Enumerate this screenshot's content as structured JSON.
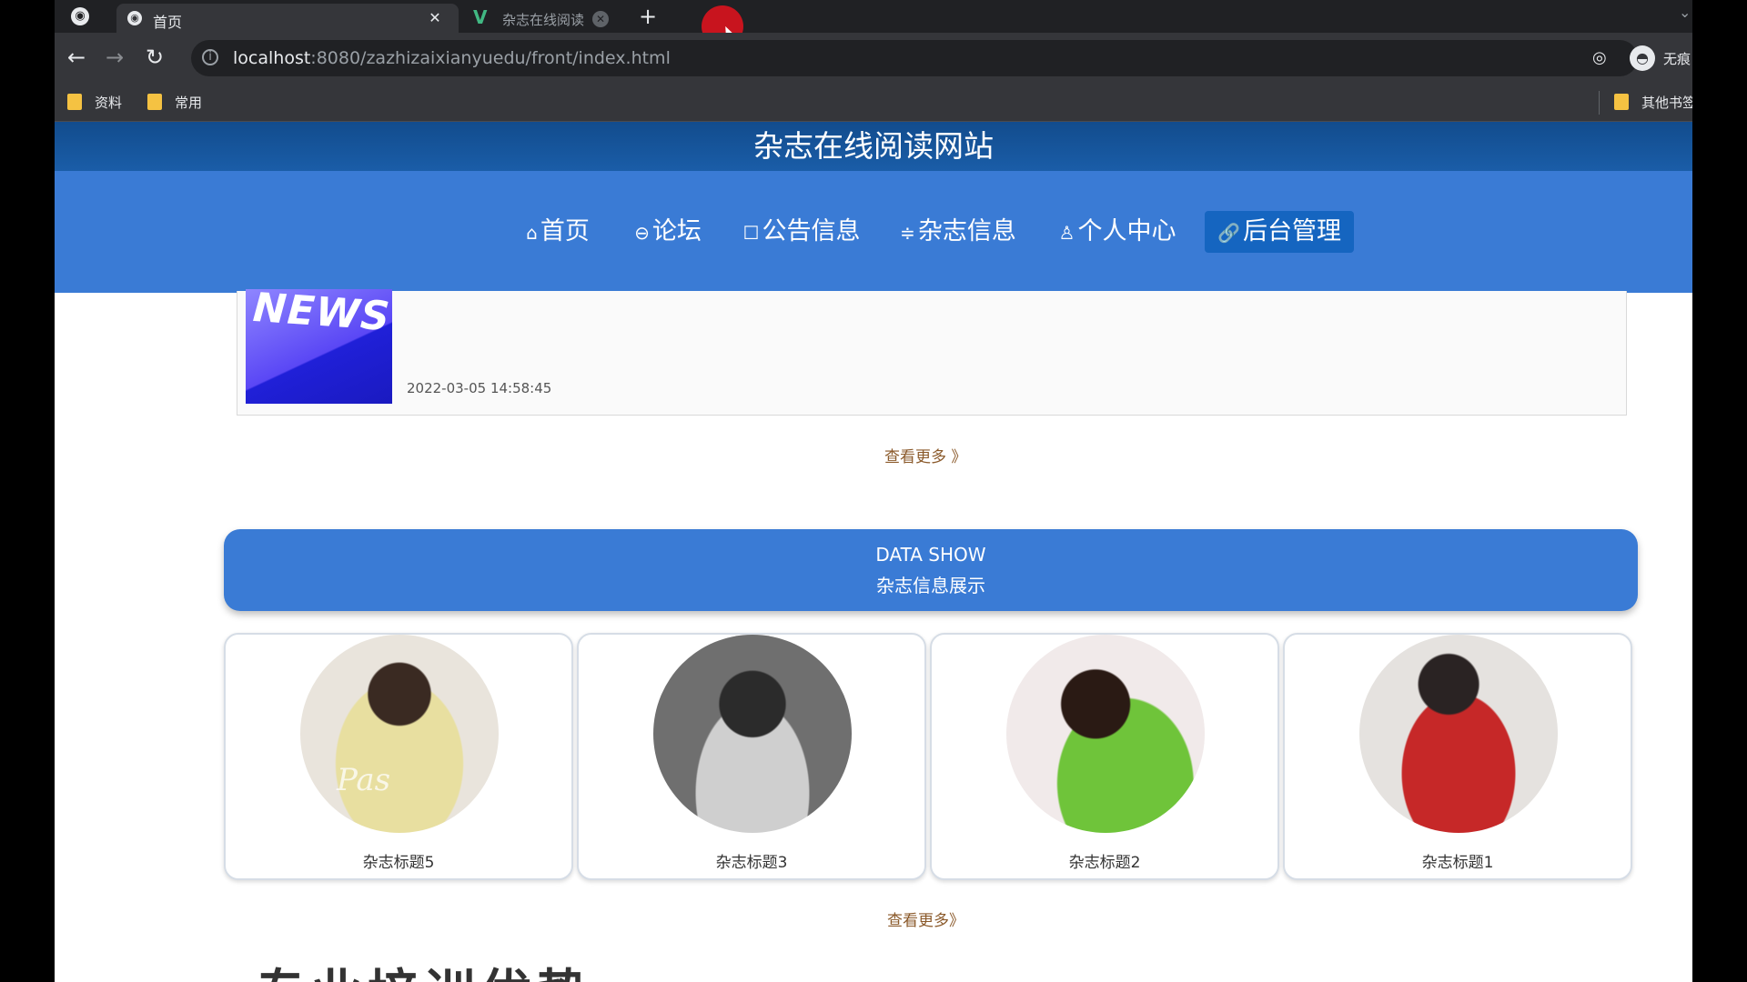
{
  "browser": {
    "tabs": [
      {
        "label": "首页",
        "active": true
      },
      {
        "label": "杂志在线阅读",
        "active": false
      }
    ],
    "url_host": "localhost",
    "url_rest": ":8080/zazhizaixianyuedu/front/index.html",
    "profile_label": "无痕",
    "bookmarks": [
      "资料",
      "常用"
    ],
    "other_bookmarks": "其他书签"
  },
  "site": {
    "title": "杂志在线阅读网站",
    "nav": [
      {
        "icon": "⌂",
        "label": "首页",
        "active": false
      },
      {
        "icon": "⊖",
        "label": "论坛",
        "active": false
      },
      {
        "icon": "☐",
        "label": "公告信息",
        "active": false
      },
      {
        "icon": "≑",
        "label": "杂志信息",
        "active": false
      },
      {
        "icon": "♙",
        "label": "个人中心",
        "active": false
      },
      {
        "icon": "🔗",
        "label": "后台管理",
        "active": true
      }
    ]
  },
  "news": {
    "thumb_text": "NEWS",
    "date": "2022-03-05 14:58:45",
    "more": "查看更多 》"
  },
  "data_show": {
    "title_en": "DATA SHOW",
    "title_cn": "杂志信息展示",
    "items": [
      {
        "title": "杂志标题5"
      },
      {
        "title": "杂志标题3"
      },
      {
        "title": "杂志标题2"
      },
      {
        "title": "杂志标题1"
      }
    ],
    "more": "查看更多》"
  },
  "next_section_heading": "专业培训优势"
}
